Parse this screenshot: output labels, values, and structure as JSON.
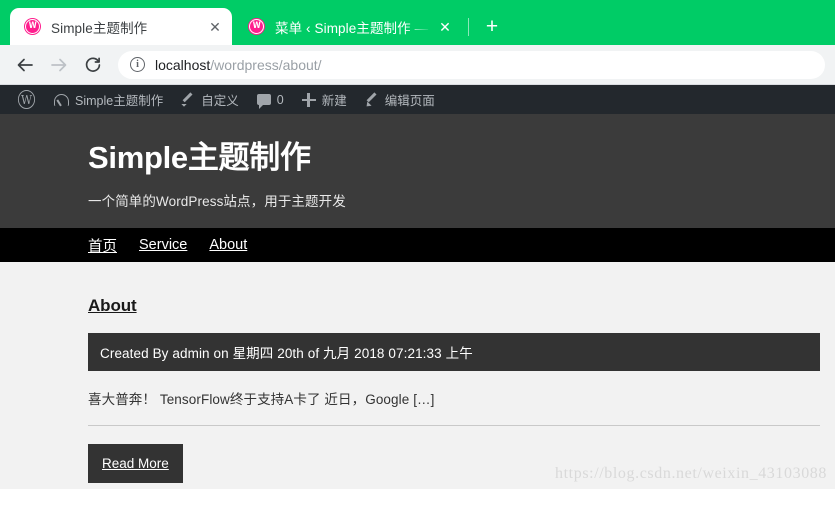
{
  "browser": {
    "tabs": [
      {
        "title": "Simple主题制作",
        "favicon": "wordpress-favicon",
        "close_label": "✕",
        "active": true
      },
      {
        "title": "菜单 ‹ Simple主题制作 — Word",
        "favicon": "wordpress-favicon",
        "close_label": "✕",
        "active": false
      }
    ],
    "new_tab_label": "+",
    "back_label": "←",
    "forward_label": "→",
    "reload_label": "⟳",
    "site_info_label": "i",
    "url_host": "localhost",
    "url_path": "/wordpress/about/"
  },
  "admin_bar": {
    "logo_label": "W",
    "items": [
      {
        "icon": "dashboard-icon",
        "label": "Simple主题制作"
      },
      {
        "icon": "customize-brush-icon",
        "label": "自定义"
      },
      {
        "icon": "comment-bubble-icon",
        "label": "0"
      },
      {
        "icon": "plus-icon",
        "label": "新建"
      },
      {
        "icon": "edit-pencil-icon",
        "label": "编辑页面"
      }
    ]
  },
  "site": {
    "title": "Simple主题制作",
    "tagline": "一个简单的WordPress站点，用于主题开发",
    "nav": [
      {
        "label": "首页"
      },
      {
        "label": "Service"
      },
      {
        "label": "About"
      }
    ]
  },
  "post": {
    "title": "About",
    "meta": "Created By admin on 星期四 20th of 九月 2018 07:21:33 上午",
    "excerpt": "喜大普奔！ TensorFlow终于支持A卡了 近日，Google […]",
    "read_more_label": "Read More"
  },
  "watermark": {
    "text": "https://blog.csdn.net/weixin_43103088"
  },
  "colors": {
    "tabstrip": "#00cc66",
    "admin_bar": "#23282d",
    "site_header": "#3b3b3b",
    "site_nav": "#000000",
    "content_bg": "#f2f2f2",
    "meta_bar": "#333333",
    "favicon": "#ff1e8e"
  }
}
